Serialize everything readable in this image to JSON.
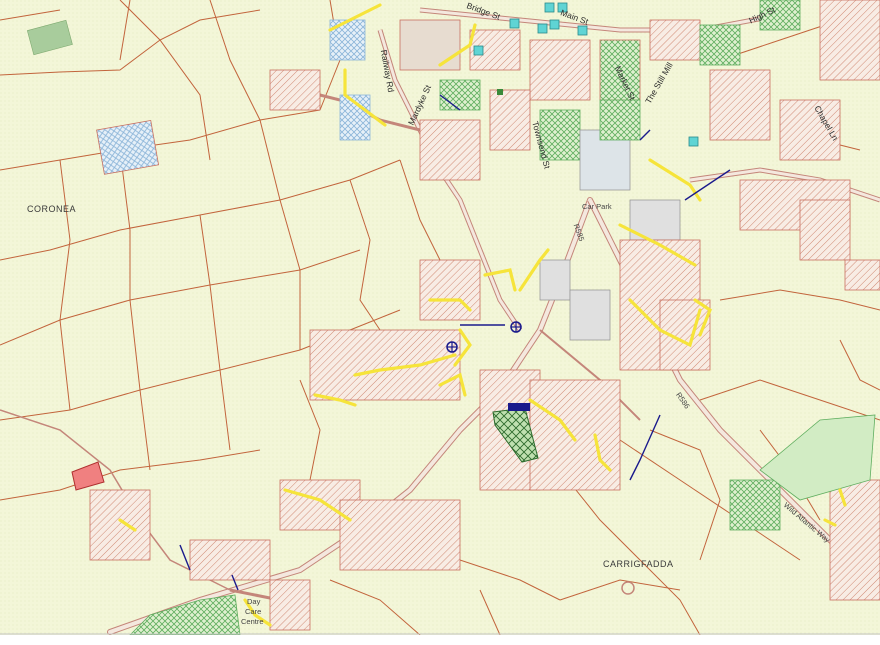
{
  "map": {
    "labels": {
      "coronea": "CORONEA",
      "carrigfadda": "CARRIGFADDA",
      "bridge_st": "Bridge St",
      "main_st": "Main St",
      "market_st": "Market St",
      "the_still_mill": "The Still Mill",
      "high_st": "High St",
      "chapel_ln": "Chapel Ln",
      "railway_rd": "Railway Rd",
      "mardyke_st": "Mardyke St",
      "townsend_st": "Townsend St",
      "car_park": "Car Park",
      "r585": "R585",
      "r586": "R586",
      "wild_atlantic_way": "Wild Atlantic Way",
      "day_care_centre_1": "Day",
      "day_care_centre_2": "Care",
      "day_care_centre_3": "Centre"
    },
    "colors": {
      "background": "#f3f6d8",
      "field_boundary": "#c2643c",
      "road": "#e8d8c8",
      "road_edge": "#c4867a",
      "site_outline": "#c87060",
      "yellow_marker": "#f6e43a",
      "cyan_marker": "#5fd4d4",
      "green_hatch": "#6fb86f",
      "blue_hatch": "#8ab4d8",
      "red_site": "#f08080",
      "navy_marker": "#1a1a8c"
    }
  }
}
